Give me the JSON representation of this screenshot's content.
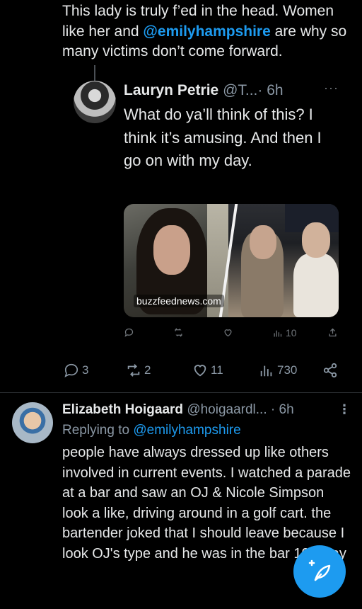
{
  "top_tweet": {
    "text_before": "This lady is truly f’ed in the head. Women like her and ",
    "mention": "@emilyhampshire",
    "text_after": " are why so many victims don’t come forward."
  },
  "quoted": {
    "name": "Lauryn Petrie",
    "handle": "@T...",
    "time": "· 6h",
    "more": "···",
    "text": "What do ya’ll think of this? I think it’s amusing. And then I go on with my day.",
    "watermark": "buzzfeednews.com",
    "views": "10"
  },
  "actions": {
    "replies": "3",
    "reposts": "2",
    "likes": "11",
    "views": "730"
  },
  "reply": {
    "name": "Elizabeth Hoigaard",
    "handle": "@hoigaardl...",
    "time": "· 6h",
    "more": "⋮",
    "replying_prefix": "Replying to ",
    "replying_to": "@emilyhampshire",
    "text": "people have always dressed up like others involved in current events. I watched a parade at a bar and saw an OJ & Nicole Simpson look a like, driving around in a golf cart. the bartender joked that  I should leave because I look OJ's type and he was in the bar 10 away"
  },
  "colors": {
    "accent": "#1d9bf0",
    "muted": "#8b98a5",
    "background": "#000000"
  },
  "icons": [
    "reply-icon",
    "repost-icon",
    "like-icon",
    "views-icon",
    "share-icon",
    "compose-icon"
  ]
}
